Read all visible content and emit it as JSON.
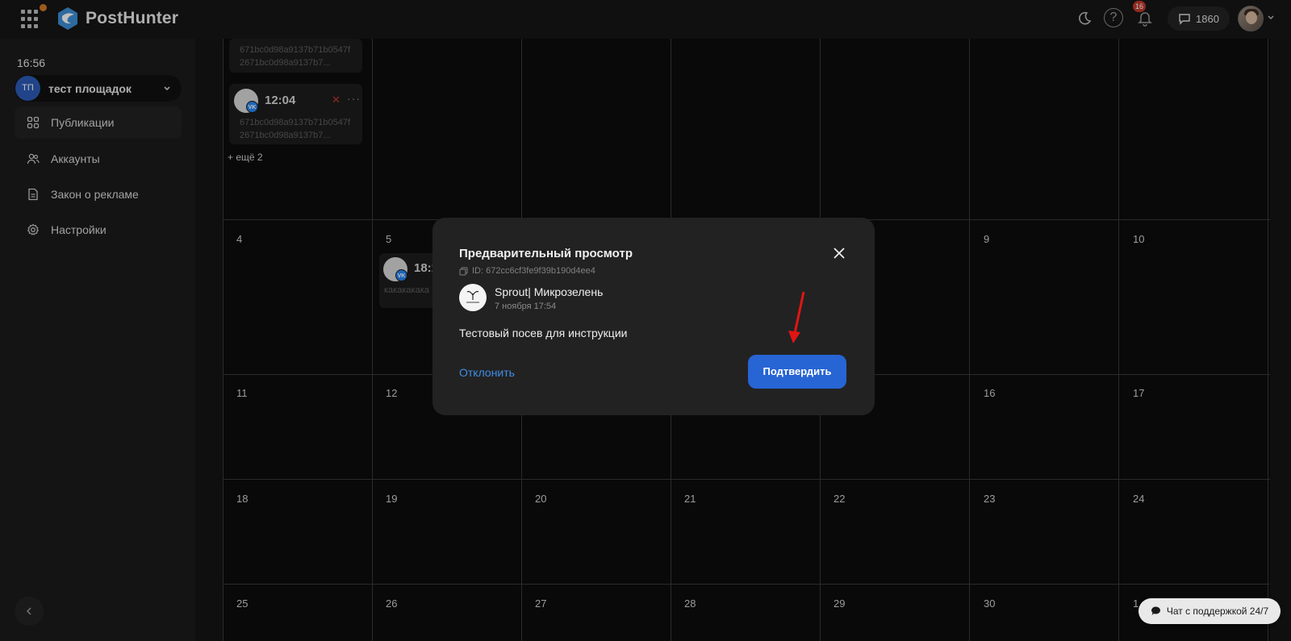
{
  "app": {
    "name": "PostHunter"
  },
  "topbar": {
    "notifications_count": "16",
    "messages_count": "1860",
    "help_label": "?"
  },
  "sidebar": {
    "time": "16:56",
    "workspace_initials": "ТП",
    "workspace_name": "тест площадок",
    "items": [
      {
        "label": "Публикации",
        "icon": "grid-icon",
        "active": true
      },
      {
        "label": "Аккаунты",
        "icon": "users-icon",
        "active": false
      },
      {
        "label": "Закон о рекламе",
        "icon": "document-icon",
        "active": false
      },
      {
        "label": "Настройки",
        "icon": "gear-icon",
        "active": false
      }
    ]
  },
  "calendar": {
    "posts": [
      {
        "hash_line1": "671bc0d98a9137b71b0547f",
        "hash_line2": "2671bc0d98a9137b7..."
      },
      {
        "time": "12:04",
        "hash_line1": "671bc0d98a9137b71b0547f",
        "hash_line2": "2671bc0d98a9137b7..."
      },
      {
        "time": "18:1",
        "text": "какакакака"
      }
    ],
    "more_label": "+ ещё 2",
    "days": [
      "4",
      "5",
      "9",
      "10",
      "11",
      "12",
      "16",
      "17",
      "18",
      "19",
      "20",
      "21",
      "22",
      "23",
      "24",
      "25",
      "26",
      "27",
      "28",
      "29",
      "30",
      "1"
    ]
  },
  "modal": {
    "title": "Предварительный просмотр",
    "id_label": "ID: 672cc6cf3fe9f39b190d4ee4",
    "account_name": "Sprout| Микрозелень",
    "date": "7 ноября 17:54",
    "text": "Тестовый посев для инструкции",
    "reject_label": "Отклонить",
    "confirm_label": "Подтвердить"
  },
  "support": {
    "label": "Чат с поддержкой 24/7"
  },
  "colors": {
    "accent": "#2764d4",
    "link": "#3f8ee8",
    "danger": "#c0392b",
    "vk": "#2787f5"
  }
}
